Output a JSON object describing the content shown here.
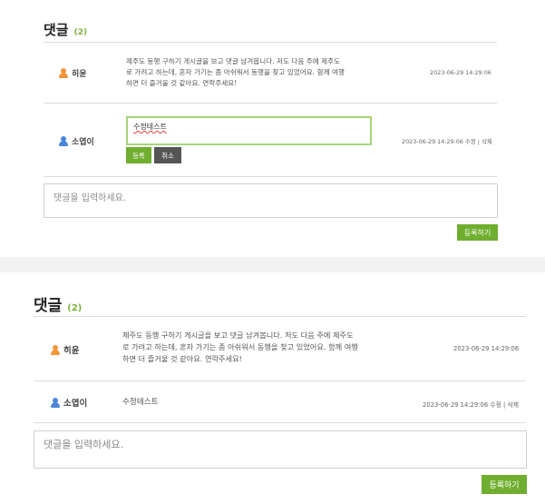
{
  "comments_section": {
    "title": "댓글",
    "count": "(2)",
    "comment1": {
      "author": "히윤",
      "content_lines": [
        "제주도 동행 구하기 게시글을 보고 댓글 남겨봅니다. 저도 다음 주에 제주도",
        "로 가려고 하는데, 혼자 가기는 좀 아쉬워서 동행을 찾고 있었어요. 함께 여행",
        "하면 더 즐거울 것 같아요. 연락주세요!"
      ],
      "date": "2023-06-29 14:29:06"
    },
    "comment2": {
      "author": "소엽이",
      "edit_value": "수정테스트",
      "edited_text": "수정테스트",
      "confirm_label": "등록",
      "cancel_label": "취소",
      "date": "2023-06-29 14:29:06",
      "edit_link": "수정",
      "separator": "|",
      "delete_link": "삭제"
    },
    "input_placeholder": "댓글을 입력하세요.",
    "submit_label": "등록하기"
  },
  "colors": {
    "accent": "#6fae2e",
    "count_green": "#7ab33a",
    "avatar_orange": "#f3963a",
    "avatar_blue": "#4a86d8"
  },
  "icons": [
    "user-icon"
  ]
}
